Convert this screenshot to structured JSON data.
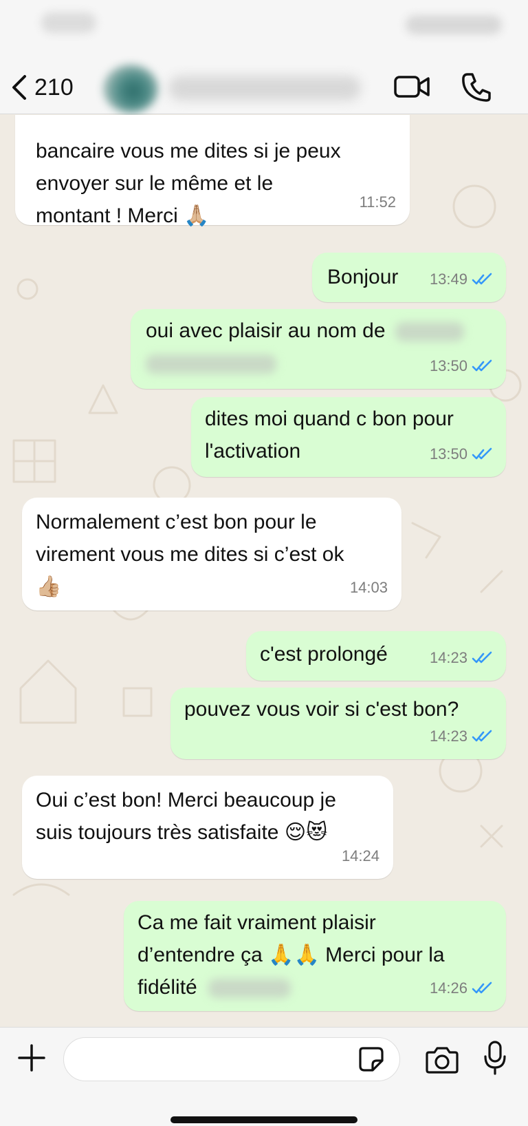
{
  "header": {
    "back_count": "210"
  },
  "messages": [
    {
      "dir": "in",
      "lines": [
        "bancaire vous me dites si je peux",
        "envoyer sur le même et le",
        "montant ! Merci 🙏🏼"
      ],
      "time": "11:52"
    },
    {
      "dir": "out",
      "lines": [
        "Bonjour"
      ],
      "time": "13:49"
    },
    {
      "dir": "out",
      "lines": [
        "oui avec plaisir au nom de"
      ],
      "time": "13:50"
    },
    {
      "dir": "out",
      "lines": [
        "dites moi quand c bon pour",
        "l'activation"
      ],
      "time": "13:50"
    },
    {
      "dir": "in",
      "lines": [
        "Normalement c’est bon pour le",
        "virement vous me dites si c’est ok",
        "👍🏼"
      ],
      "time": "14:03"
    },
    {
      "dir": "out",
      "lines": [
        "c'est prolongé"
      ],
      "time": "14:23"
    },
    {
      "dir": "out",
      "lines": [
        "pouvez vous voir si c'est bon?"
      ],
      "time": "14:23"
    },
    {
      "dir": "in",
      "lines": [
        "Oui c’est bon! Merci beaucoup je",
        "suis toujours très satisfaite 😌😻"
      ],
      "time": "14:24"
    },
    {
      "dir": "out",
      "lines": [
        "Ca me fait vraiment plaisir",
        "d’entendre ça 🙏🙏 Merci pour la",
        "fidélité"
      ],
      "time": "14:26"
    }
  ],
  "composer": {
    "input_value": "",
    "icons": [
      "plus-icon",
      "sticker-icon",
      "camera-icon",
      "microphone-icon"
    ]
  },
  "colors": {
    "incoming_bubble": "#ffffff",
    "outgoing_bubble": "#d9fdd3",
    "read_tick": "#3497f9",
    "wallpaper": "#f0ebe3"
  }
}
